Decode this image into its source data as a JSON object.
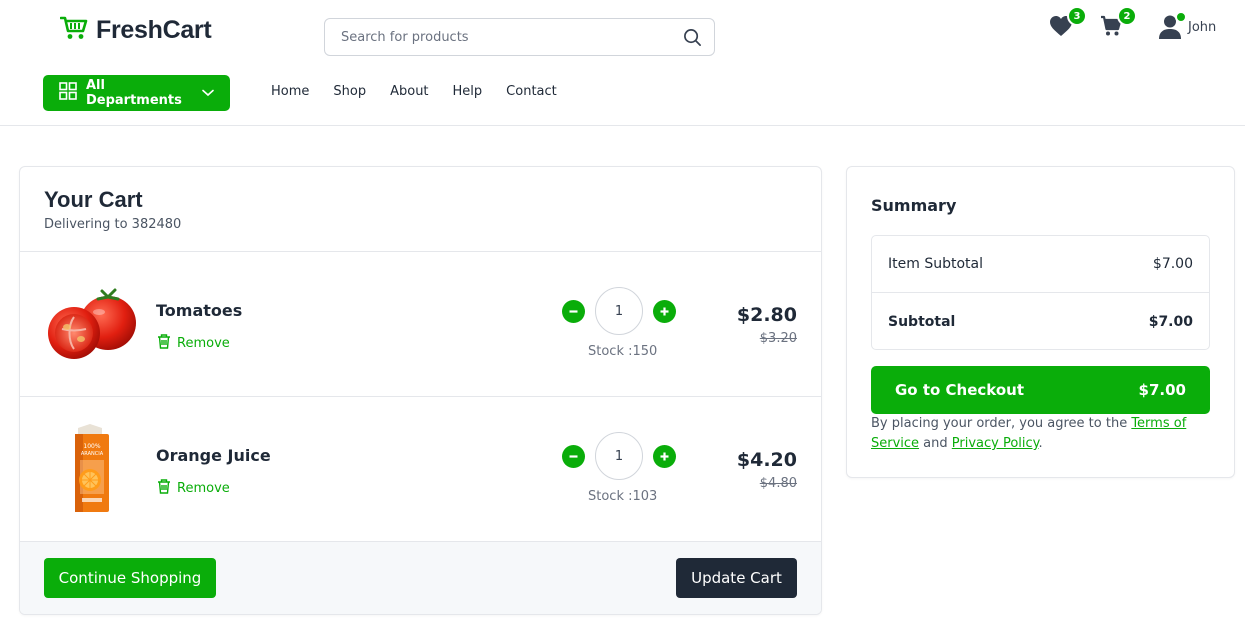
{
  "brand": {
    "name": "FreshCart",
    "color": "#0aad0a"
  },
  "search": {
    "placeholder": "Search for products"
  },
  "header": {
    "wishlist_count": "3",
    "cart_count": "2",
    "user_name": "John"
  },
  "nav": {
    "departments_label": "All Departments",
    "links": [
      "Home",
      "Shop",
      "About",
      "Help",
      "Contact"
    ]
  },
  "cart": {
    "title": "Your Cart",
    "subtitle": "Delivering to 382480",
    "items": [
      {
        "name": "Tomatoes",
        "remove_label": "Remove",
        "quantity": "1",
        "stock": "Stock :150",
        "price": "$2.80",
        "old_price": "$3.20",
        "image": "tomato-image"
      },
      {
        "name": "Orange Juice",
        "remove_label": "Remove",
        "quantity": "1",
        "stock": "Stock :103",
        "price": "$4.20",
        "old_price": "$4.80",
        "image": "orange-juice-image"
      }
    ],
    "continue_label": "Continue Shopping",
    "update_label": "Update Cart"
  },
  "summary": {
    "title": "Summary",
    "item_subtotal_label": "Item Subtotal",
    "item_subtotal_value": "$7.00",
    "subtotal_label": "Subtotal",
    "subtotal_value": "$7.00",
    "checkout_label": "Go to Checkout",
    "checkout_value": "$7.00",
    "terms_prefix": "By placing your order, you agree to the ",
    "terms_link": "Terms of Service",
    "terms_middle": " and ",
    "privacy_link": "Privacy Policy",
    "terms_suffix": "."
  },
  "colors": {
    "accent": "#0aad0a",
    "dark": "#1f2937",
    "muted": "#6b7280",
    "border": "#e5e7eb"
  }
}
